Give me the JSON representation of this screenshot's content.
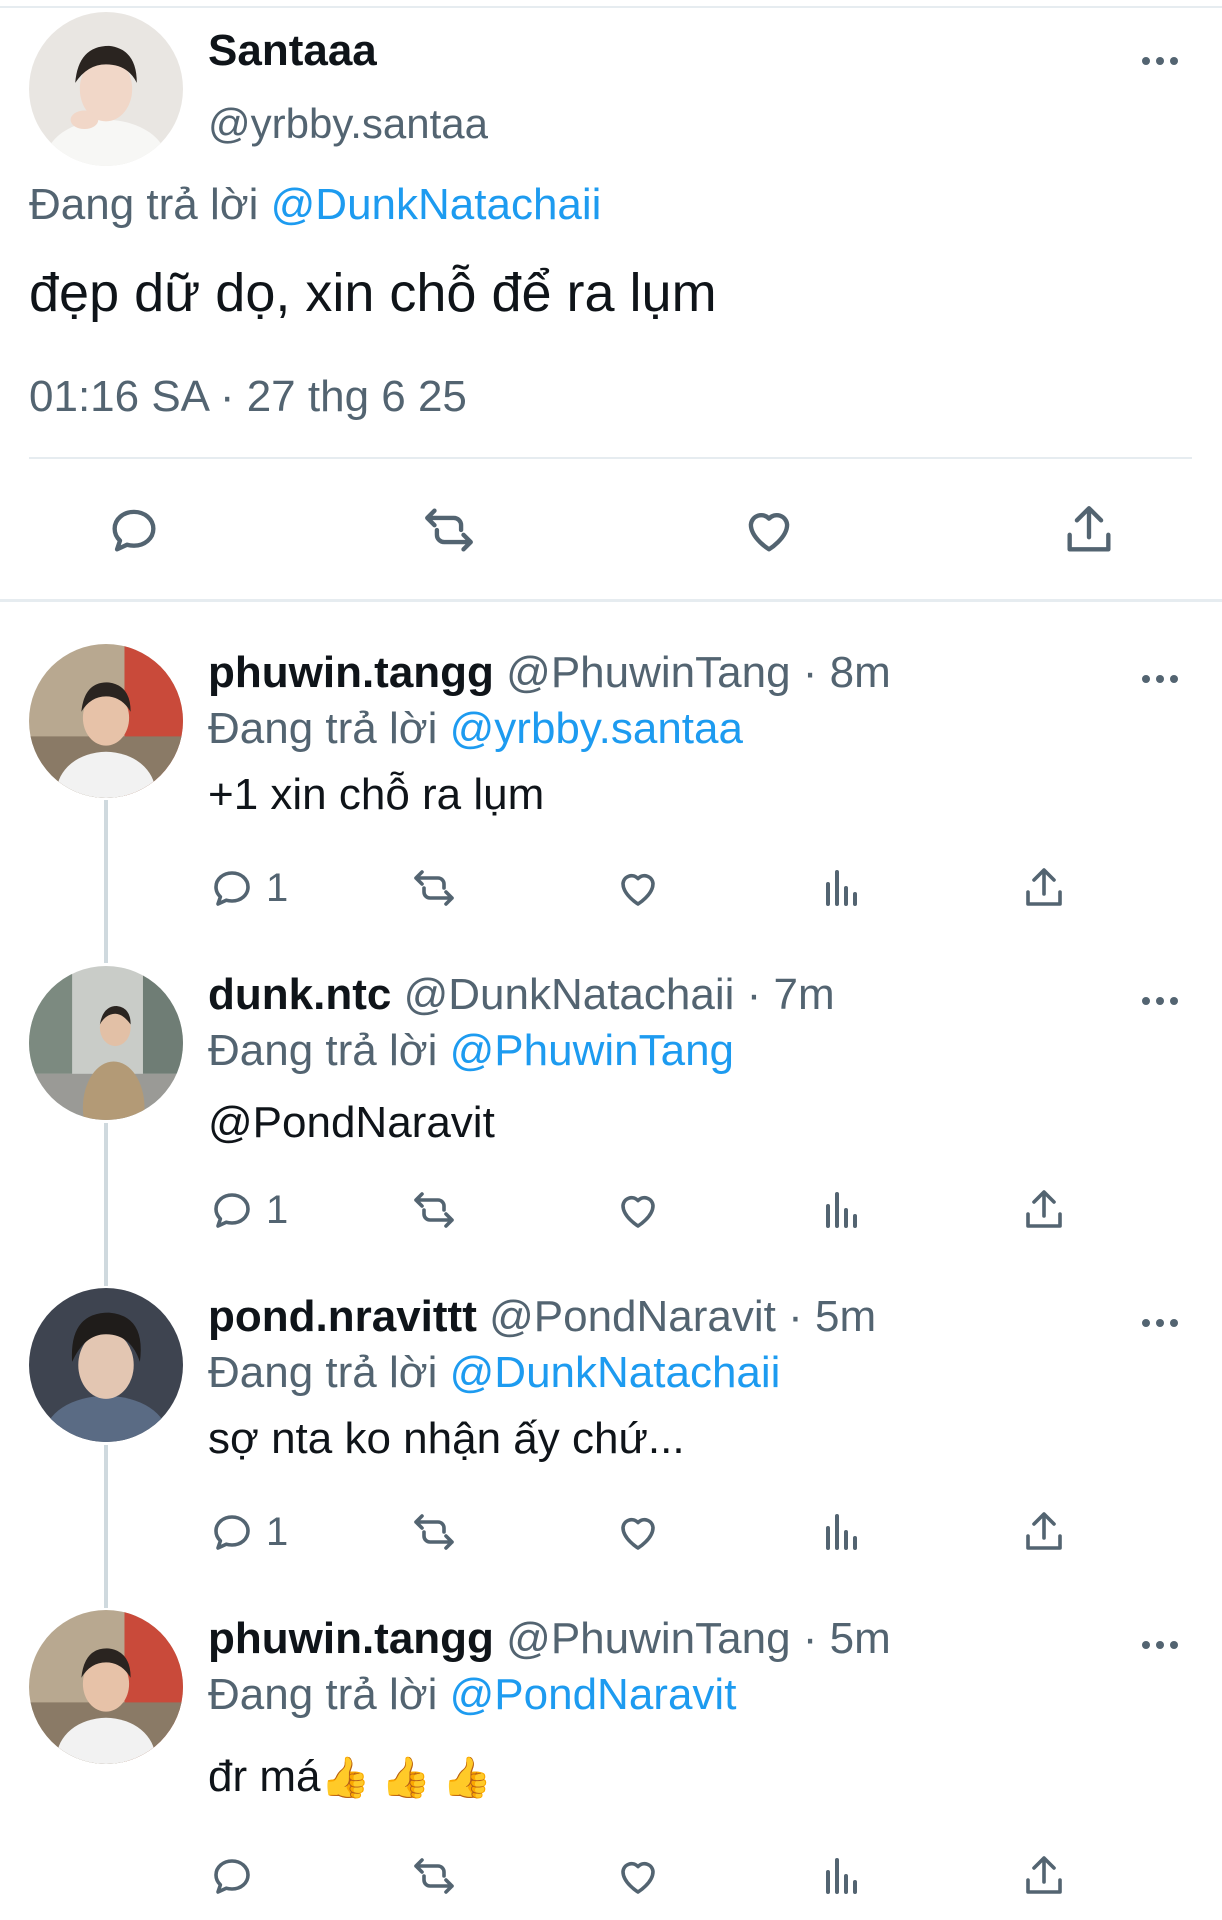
{
  "main_tweet": {
    "name": "Santaaa",
    "handle": "@yrbby.santaa",
    "reply_prefix": "Đang trả lời",
    "reply_to": "@DunkNatachaii",
    "text": "đẹp dữ dọ, xin chỗ để ra lụm",
    "timestamp": "01:16 SA · 27 thg 6 25",
    "actions": [
      "reply-icon",
      "retweet-icon",
      "like-icon",
      "share-icon"
    ]
  },
  "replies": [
    {
      "name": "phuwin.tangg",
      "handle": "@PhuwinTang",
      "time": "· 8m",
      "reply_prefix": "Đang trả lời",
      "reply_to": "@yrbby.santaa",
      "text": "+1 xin chỗ ra lụm",
      "reply_count": "1"
    },
    {
      "name": "dunk.ntc",
      "handle": "@DunkNatachaii",
      "time": "· 7m",
      "reply_prefix": "Đang trả lời",
      "reply_to": "@PhuwinTang",
      "text": "@PondNaravit",
      "reply_count": "1"
    },
    {
      "name": "pond.nravittt",
      "handle": "@PondNaravit",
      "time": "· 5m",
      "reply_prefix": "Đang trả lời",
      "reply_to": "@DunkNatachaii",
      "text": "sợ nta ko nhận ấy chứ...",
      "reply_count": "1"
    },
    {
      "name": "phuwin.tangg",
      "handle": "@PhuwinTang",
      "time": "· 5m",
      "reply_prefix": "Đang trả lời",
      "reply_to": "@PondNaravit",
      "text": "đr má",
      "emoji": "👍 👍 👍",
      "reply_count": ""
    }
  ],
  "colors": {
    "link": "#1d9bf0",
    "secondary_text": "#536471",
    "primary_text": "#0f1419",
    "divider": "#e6ecf0"
  }
}
